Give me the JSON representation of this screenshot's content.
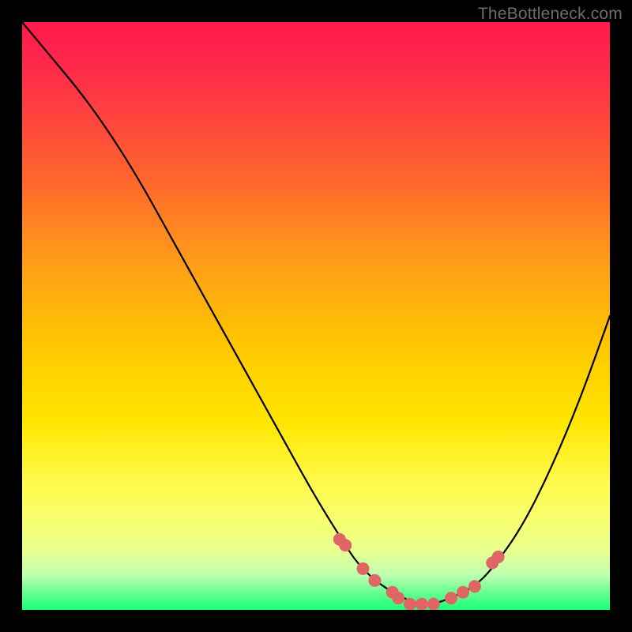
{
  "watermark": "TheBottleneck.com",
  "chart_data": {
    "type": "line",
    "title": "",
    "xlabel": "",
    "ylabel": "",
    "xlim": [
      0,
      100
    ],
    "ylim": [
      0,
      100
    ],
    "grid": false,
    "legend": false,
    "series": [
      {
        "name": "bottleneck-curve",
        "x": [
          0,
          5,
          10,
          15,
          20,
          25,
          30,
          35,
          40,
          45,
          50,
          55,
          57,
          60,
          63,
          67,
          70,
          73,
          77,
          80,
          85,
          90,
          95,
          100
        ],
        "y": [
          100,
          94,
          88,
          81,
          73,
          64,
          55,
          46,
          37,
          28,
          19,
          11,
          8,
          5,
          3,
          1,
          1,
          2,
          4,
          7,
          14,
          24,
          36,
          50
        ]
      }
    ],
    "markers": {
      "name": "highlighted-points",
      "color": "#e06666",
      "radius_px": 8,
      "x": [
        54,
        55,
        58,
        60,
        63,
        64,
        66,
        68,
        70,
        73,
        75,
        77,
        80,
        81
      ],
      "y": [
        12,
        11,
        7,
        5,
        3,
        2,
        1,
        1,
        1,
        2,
        3,
        4,
        8,
        9
      ]
    }
  }
}
